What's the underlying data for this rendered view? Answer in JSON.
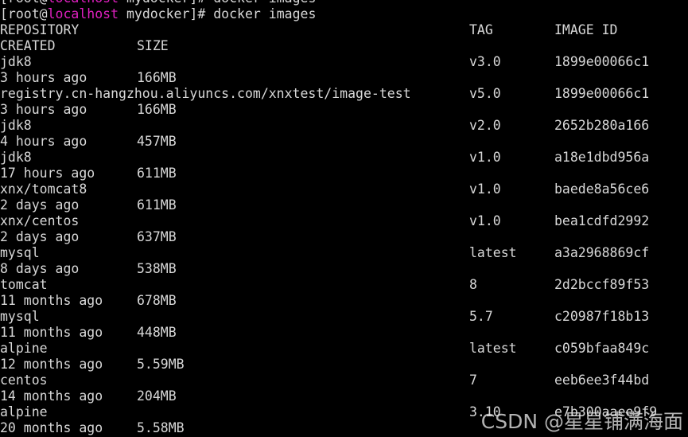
{
  "terminal": {
    "prompt": {
      "prefix": "[root@",
      "host": "localhost",
      "suffix": " mydocker]# ",
      "command": "docker images"
    },
    "colors": {
      "background": "#000000",
      "foreground": "#d8d8d8",
      "host_magenta": "#e020c0",
      "watermark": "#e4e4e4"
    },
    "headers": {
      "repository": "REPOSITORY",
      "tag": "TAG",
      "image_id": "IMAGE ID",
      "created": "CREATED",
      "size": "SIZE"
    },
    "rows": [
      {
        "repository": "jdk8",
        "tag": "v3.0",
        "image_id": "1899e00066c1",
        "created": "3 hours ago",
        "size": "166MB"
      },
      {
        "repository": "registry.cn-hangzhou.aliyuncs.com/xnxtest/image-test",
        "tag": "v5.0",
        "image_id": "1899e00066c1",
        "created": "3 hours ago",
        "size": "166MB"
      },
      {
        "repository": "jdk8",
        "tag": "v2.0",
        "image_id": "2652b280a166",
        "created": "4 hours ago",
        "size": "457MB"
      },
      {
        "repository": "jdk8",
        "tag": "v1.0",
        "image_id": "a18e1dbd956a",
        "created": "17 hours ago",
        "size": "611MB"
      },
      {
        "repository": "xnx/tomcat8",
        "tag": "v1.0",
        "image_id": "baede8a56ce6",
        "created": "2 days ago",
        "size": "611MB"
      },
      {
        "repository": "xnx/centos",
        "tag": "v1.0",
        "image_id": "bea1cdfd2992",
        "created": "2 days ago",
        "size": "637MB"
      },
      {
        "repository": "mysql",
        "tag": "latest",
        "image_id": "a3a2968869cf",
        "created": "8 days ago",
        "size": "538MB"
      },
      {
        "repository": "tomcat",
        "tag": "8",
        "image_id": "2d2bccf89f53",
        "created": "11 months ago",
        "size": "678MB"
      },
      {
        "repository": "mysql",
        "tag": "5.7",
        "image_id": "c20987f18b13",
        "created": "11 months ago",
        "size": "448MB"
      },
      {
        "repository": "alpine",
        "tag": "latest",
        "image_id": "c059bfaa849c",
        "created": "12 months ago",
        "size": "5.59MB"
      },
      {
        "repository": "centos",
        "tag": "7",
        "image_id": "eeb6ee3f44bd",
        "created": "14 months ago",
        "size": "204MB"
      },
      {
        "repository": "alpine",
        "tag": "3.10",
        "image_id": "e7b300aaee9f9",
        "created": "20 months ago",
        "size": "5.58MB"
      }
    ],
    "watermark": "CSDN @星星铺满海面"
  }
}
